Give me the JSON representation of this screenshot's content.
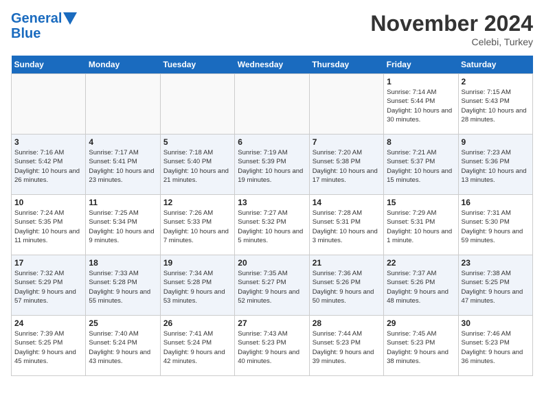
{
  "header": {
    "logo_line1": "General",
    "logo_line2": "Blue",
    "month": "November 2024",
    "location": "Celebi, Turkey"
  },
  "weekdays": [
    "Sunday",
    "Monday",
    "Tuesday",
    "Wednesday",
    "Thursday",
    "Friday",
    "Saturday"
  ],
  "weeks": [
    [
      {
        "day": "",
        "info": ""
      },
      {
        "day": "",
        "info": ""
      },
      {
        "day": "",
        "info": ""
      },
      {
        "day": "",
        "info": ""
      },
      {
        "day": "",
        "info": ""
      },
      {
        "day": "1",
        "info": "Sunrise: 7:14 AM\nSunset: 5:44 PM\nDaylight: 10 hours and 30 minutes."
      },
      {
        "day": "2",
        "info": "Sunrise: 7:15 AM\nSunset: 5:43 PM\nDaylight: 10 hours and 28 minutes."
      }
    ],
    [
      {
        "day": "3",
        "info": "Sunrise: 7:16 AM\nSunset: 5:42 PM\nDaylight: 10 hours and 26 minutes."
      },
      {
        "day": "4",
        "info": "Sunrise: 7:17 AM\nSunset: 5:41 PM\nDaylight: 10 hours and 23 minutes."
      },
      {
        "day": "5",
        "info": "Sunrise: 7:18 AM\nSunset: 5:40 PM\nDaylight: 10 hours and 21 minutes."
      },
      {
        "day": "6",
        "info": "Sunrise: 7:19 AM\nSunset: 5:39 PM\nDaylight: 10 hours and 19 minutes."
      },
      {
        "day": "7",
        "info": "Sunrise: 7:20 AM\nSunset: 5:38 PM\nDaylight: 10 hours and 17 minutes."
      },
      {
        "day": "8",
        "info": "Sunrise: 7:21 AM\nSunset: 5:37 PM\nDaylight: 10 hours and 15 minutes."
      },
      {
        "day": "9",
        "info": "Sunrise: 7:23 AM\nSunset: 5:36 PM\nDaylight: 10 hours and 13 minutes."
      }
    ],
    [
      {
        "day": "10",
        "info": "Sunrise: 7:24 AM\nSunset: 5:35 PM\nDaylight: 10 hours and 11 minutes."
      },
      {
        "day": "11",
        "info": "Sunrise: 7:25 AM\nSunset: 5:34 PM\nDaylight: 10 hours and 9 minutes."
      },
      {
        "day": "12",
        "info": "Sunrise: 7:26 AM\nSunset: 5:33 PM\nDaylight: 10 hours and 7 minutes."
      },
      {
        "day": "13",
        "info": "Sunrise: 7:27 AM\nSunset: 5:32 PM\nDaylight: 10 hours and 5 minutes."
      },
      {
        "day": "14",
        "info": "Sunrise: 7:28 AM\nSunset: 5:31 PM\nDaylight: 10 hours and 3 minutes."
      },
      {
        "day": "15",
        "info": "Sunrise: 7:29 AM\nSunset: 5:31 PM\nDaylight: 10 hours and 1 minute."
      },
      {
        "day": "16",
        "info": "Sunrise: 7:31 AM\nSunset: 5:30 PM\nDaylight: 9 hours and 59 minutes."
      }
    ],
    [
      {
        "day": "17",
        "info": "Sunrise: 7:32 AM\nSunset: 5:29 PM\nDaylight: 9 hours and 57 minutes."
      },
      {
        "day": "18",
        "info": "Sunrise: 7:33 AM\nSunset: 5:28 PM\nDaylight: 9 hours and 55 minutes."
      },
      {
        "day": "19",
        "info": "Sunrise: 7:34 AM\nSunset: 5:28 PM\nDaylight: 9 hours and 53 minutes."
      },
      {
        "day": "20",
        "info": "Sunrise: 7:35 AM\nSunset: 5:27 PM\nDaylight: 9 hours and 52 minutes."
      },
      {
        "day": "21",
        "info": "Sunrise: 7:36 AM\nSunset: 5:26 PM\nDaylight: 9 hours and 50 minutes."
      },
      {
        "day": "22",
        "info": "Sunrise: 7:37 AM\nSunset: 5:26 PM\nDaylight: 9 hours and 48 minutes."
      },
      {
        "day": "23",
        "info": "Sunrise: 7:38 AM\nSunset: 5:25 PM\nDaylight: 9 hours and 47 minutes."
      }
    ],
    [
      {
        "day": "24",
        "info": "Sunrise: 7:39 AM\nSunset: 5:25 PM\nDaylight: 9 hours and 45 minutes."
      },
      {
        "day": "25",
        "info": "Sunrise: 7:40 AM\nSunset: 5:24 PM\nDaylight: 9 hours and 43 minutes."
      },
      {
        "day": "26",
        "info": "Sunrise: 7:41 AM\nSunset: 5:24 PM\nDaylight: 9 hours and 42 minutes."
      },
      {
        "day": "27",
        "info": "Sunrise: 7:43 AM\nSunset: 5:23 PM\nDaylight: 9 hours and 40 minutes."
      },
      {
        "day": "28",
        "info": "Sunrise: 7:44 AM\nSunset: 5:23 PM\nDaylight: 9 hours and 39 minutes."
      },
      {
        "day": "29",
        "info": "Sunrise: 7:45 AM\nSunset: 5:23 PM\nDaylight: 9 hours and 38 minutes."
      },
      {
        "day": "30",
        "info": "Sunrise: 7:46 AM\nSunset: 5:23 PM\nDaylight: 9 hours and 36 minutes."
      }
    ]
  ]
}
